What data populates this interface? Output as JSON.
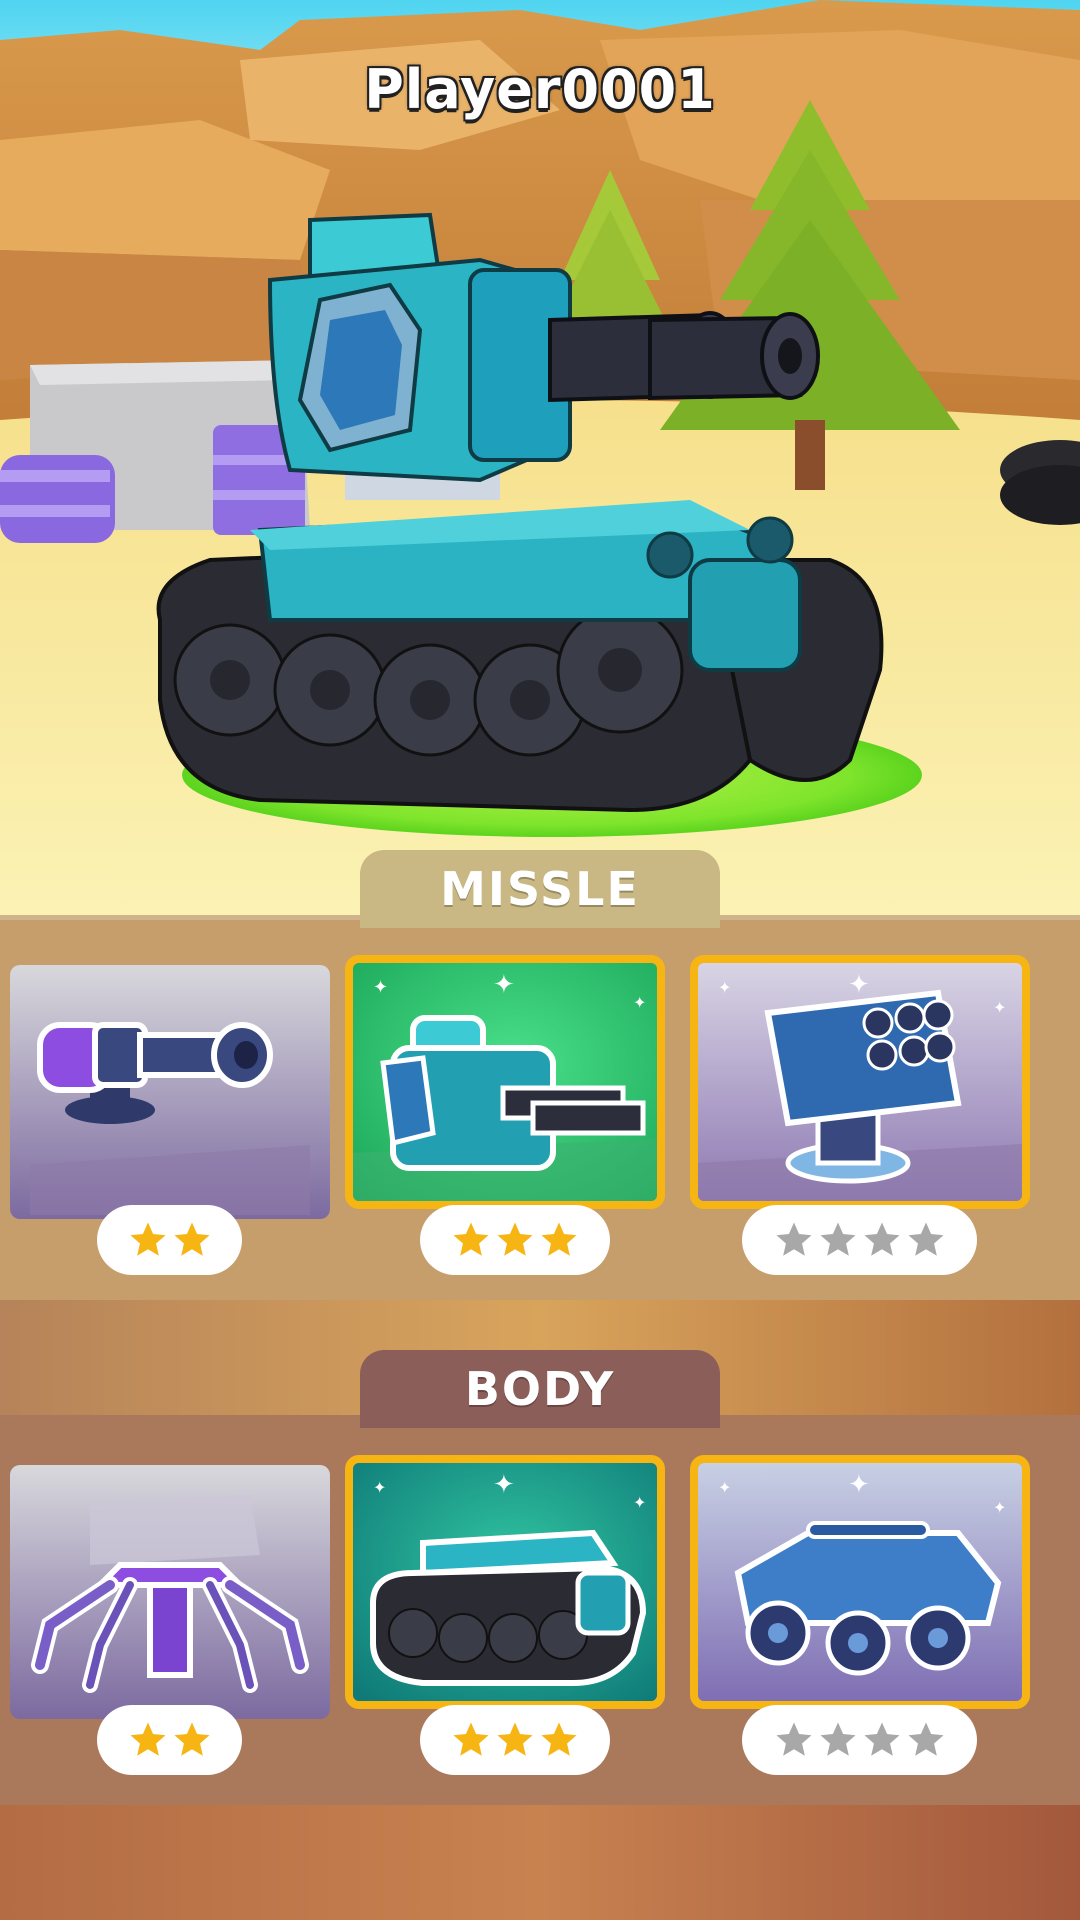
{
  "player": {
    "name": "Player0001"
  },
  "sections": [
    {
      "title": "MISSLE",
      "items": [
        {
          "name": "Purple Cannon",
          "stars_filled": 2,
          "stars_total": 2,
          "selected": false
        },
        {
          "name": "Twin Barrel Turret",
          "stars_filled": 3,
          "stars_total": 3,
          "selected": true
        },
        {
          "name": "Rocket Launcher",
          "stars_filled": 0,
          "stars_total": 4,
          "selected": false
        }
      ]
    },
    {
      "title": "BODY",
      "items": [
        {
          "name": "Spider Legs",
          "stars_filled": 2,
          "stars_total": 2,
          "selected": false
        },
        {
          "name": "Tracked Chassis",
          "stars_filled": 3,
          "stars_total": 3,
          "selected": true
        },
        {
          "name": "Six Wheeler",
          "stars_filled": 0,
          "stars_total": 4,
          "selected": false
        }
      ]
    }
  ],
  "colors": {
    "selected_border": "#f7b514",
    "star_gold": "#f7b514",
    "star_gray": "#a8a8a8",
    "tank_teal": "#2ab4c4",
    "platform_green": "#6ee02a"
  }
}
